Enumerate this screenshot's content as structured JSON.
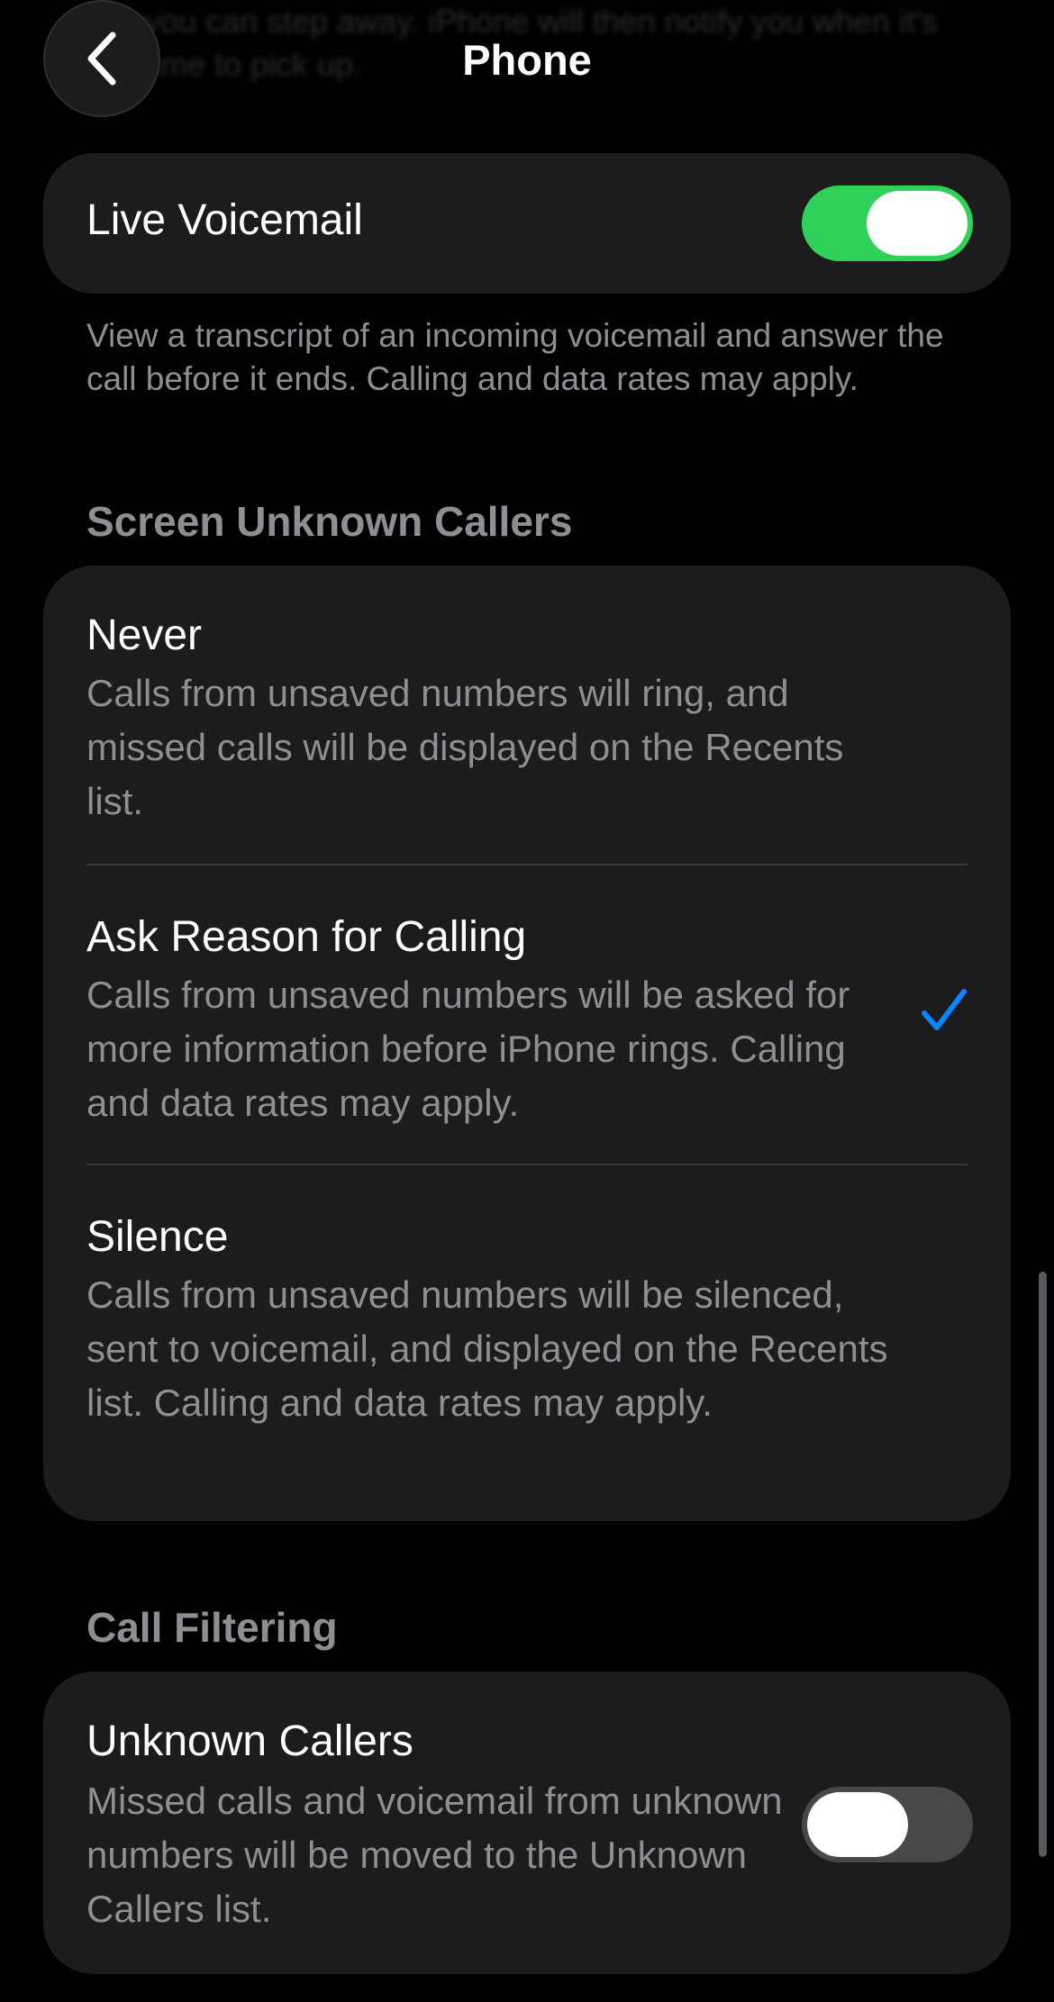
{
  "header": {
    "title": "Phone",
    "back_label": "Back",
    "obscured_text": "you can step away. iPhone will then notify you when it's time to pick up."
  },
  "live_voicemail": {
    "label": "Live Voicemail",
    "enabled": true,
    "footer": "View a transcript of an incoming voicemail and answer the call before it ends. Calling and data rates may apply."
  },
  "screen_unknown_callers": {
    "header": "Screen Unknown Callers",
    "options": [
      {
        "title": "Never",
        "description": "Calls from unsaved numbers will ring, and missed calls will be displayed on the Recents list.",
        "selected": false
      },
      {
        "title": "Ask Reason for Calling",
        "description": "Calls from unsaved numbers will be asked for more information before iPhone rings. Calling and data rates may apply.",
        "selected": true
      },
      {
        "title": "Silence",
        "description": "Calls from unsaved numbers will be silenced, sent to voicemail, and displayed on the Recents list. Calling and data rates may apply.",
        "selected": false
      }
    ]
  },
  "call_filtering": {
    "header": "Call Filtering",
    "unknown_callers": {
      "title": "Unknown Callers",
      "description": "Missed calls and voicemail from unknown numbers will be moved to the Unknown Callers list.",
      "enabled": false
    }
  },
  "icons": {
    "back": "chevron-left-icon",
    "selected": "checkmark-icon"
  },
  "colors": {
    "accent": "#0a84ff",
    "toggle_on": "#30d158",
    "toggle_off": "#48484b",
    "card": "#1c1c1e",
    "secondary_text": "#8e8e93",
    "background": "#000000"
  }
}
